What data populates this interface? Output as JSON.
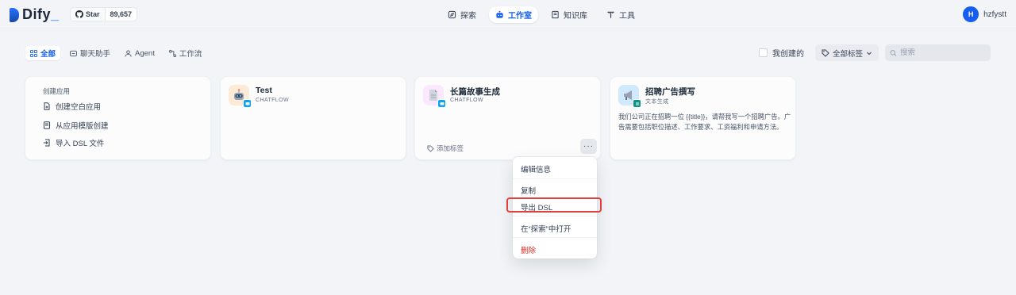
{
  "brand": {
    "name": "Dify",
    "underscore": "_"
  },
  "github": {
    "label": "Star",
    "count": "89,657"
  },
  "nav": [
    {
      "label": "探索",
      "icon": "explore-icon"
    },
    {
      "label": "工作室",
      "icon": "robot-icon",
      "active": true
    },
    {
      "label": "知识库",
      "icon": "book-icon"
    },
    {
      "label": "工具",
      "icon": "tool-icon"
    }
  ],
  "user": {
    "initial": "H",
    "name": "hzfystt"
  },
  "filters": [
    {
      "label": "全部",
      "active": true
    },
    {
      "label": "聊天助手"
    },
    {
      "label": "Agent"
    },
    {
      "label": "工作流"
    }
  ],
  "toolbar": {
    "created_by_me": "我创建的",
    "tag_select": "全部标签",
    "search_placeholder": "搜索"
  },
  "create_card": {
    "title": "创建应用",
    "items": [
      "创建空白应用",
      "从应用模版创建",
      "导入 DSL 文件"
    ]
  },
  "apps": [
    {
      "name": "Test",
      "mode": "CHATFLOW",
      "icon_bg": "#fdead7",
      "badge_color": "#0ba5ec"
    },
    {
      "name": "长篇故事生成",
      "mode": "CHATFLOW",
      "icon_bg": "#fbe8ff",
      "badge_color": "#0ba5ec",
      "tag_add": "添加标签"
    },
    {
      "name": "招聘广告撰写",
      "mode": "文本生成",
      "icon_bg": "#d1e9ff",
      "badge_color": "#0e9384",
      "description": "我们公司正在招聘一位 {{title}}，请帮我写一个招聘广告。广告需要包括职位描述、工作要求、工资福利和申请方法。"
    }
  ],
  "context_menu": {
    "items": [
      "编辑信息",
      "复制",
      "导出 DSL",
      "在“探索”中打开",
      "删除"
    ]
  },
  "colors": {
    "accent": "#155eef",
    "danger": "#d92d20",
    "highlight": "#e0413e"
  }
}
